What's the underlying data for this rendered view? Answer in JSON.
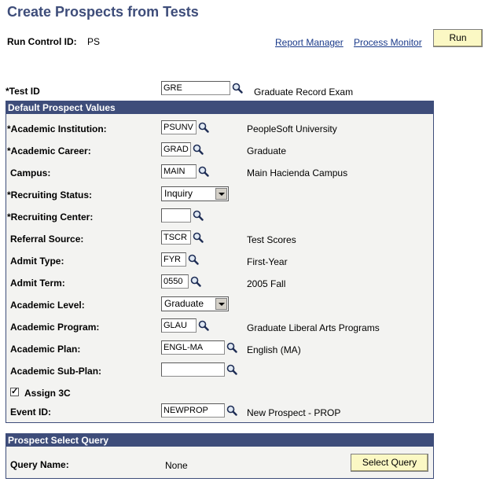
{
  "page": {
    "title": "Create Prospects from Tests"
  },
  "run_control": {
    "label": "Run Control ID:",
    "value": "PS"
  },
  "links": {
    "report_manager": "Report Manager",
    "process_monitor": "Process Monitor"
  },
  "buttons": {
    "run": "Run",
    "select_query": "Select Query"
  },
  "test": {
    "label": "*Test ID",
    "value": "GRE",
    "desc": "Graduate Record Exam"
  },
  "defaults": {
    "header": "Default Prospect Values",
    "institution": {
      "label": "*Academic Institution:",
      "value": "PSUNV",
      "desc": "PeopleSoft University"
    },
    "career": {
      "label": "*Academic Career:",
      "value": "GRAD",
      "desc": "Graduate"
    },
    "campus": {
      "label": "Campus:",
      "value": "MAIN",
      "desc": "Main Hacienda Campus"
    },
    "recruiting_status": {
      "label": "*Recruiting Status:",
      "value": "Inquiry"
    },
    "recruiting_center": {
      "label": "*Recruiting Center:",
      "value": ""
    },
    "referral_source": {
      "label": "Referral Source:",
      "value": "TSCR",
      "desc": "Test Scores"
    },
    "admit_type": {
      "label": "Admit Type:",
      "value": "FYR",
      "desc": "First-Year"
    },
    "admit_term": {
      "label": "Admit Term:",
      "value": "0550",
      "desc": "2005 Fall"
    },
    "academic_level": {
      "label": "Academic Level:",
      "value": "Graduate"
    },
    "academic_program": {
      "label": "Academic Program:",
      "value": "GLAU",
      "desc": "Graduate Liberal Arts Programs"
    },
    "academic_plan": {
      "label": "Academic Plan:",
      "value": "ENGL-MA",
      "desc": "English (MA)"
    },
    "academic_subplan": {
      "label": "Academic Sub-Plan:",
      "value": ""
    },
    "assign_3c": {
      "label": "Assign 3C",
      "checked": true
    },
    "event_id": {
      "label": "Event ID:",
      "value": "NEWPROP",
      "desc": "New Prospect - PROP"
    }
  },
  "query": {
    "header": "Prospect Select Query",
    "label": "Query Name:",
    "value": "None"
  },
  "icons": {
    "lookup": "magnifier-icon",
    "dropdown": "dropdown-arrow-icon",
    "check": "checkmark-icon"
  }
}
